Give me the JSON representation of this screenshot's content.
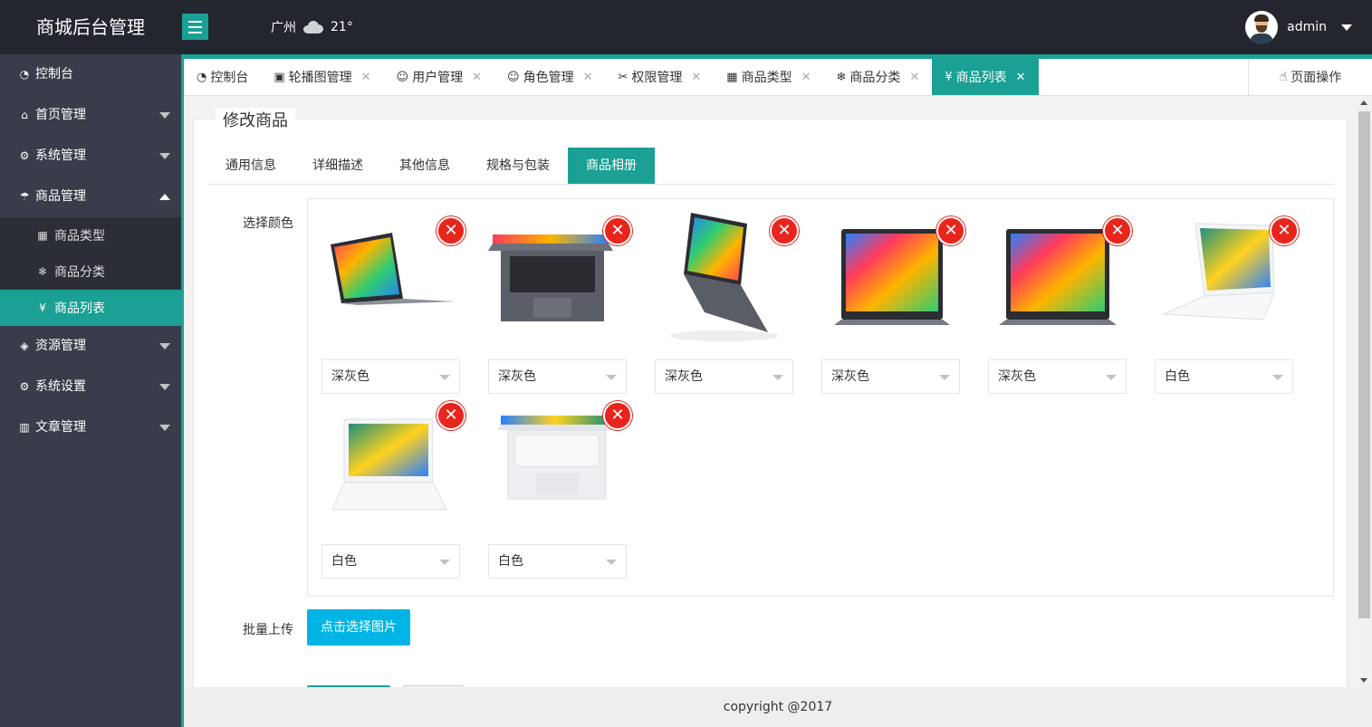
{
  "header": {
    "brand": "商城后台管理",
    "city": "广州",
    "temperature": "21°",
    "username": "admin"
  },
  "sidebar": {
    "items": [
      {
        "label": "控制台",
        "icon": "dashboard-icon"
      },
      {
        "label": "首页管理",
        "icon": "home-icon"
      },
      {
        "label": "系统管理",
        "icon": "gear-icon"
      },
      {
        "label": "商品管理",
        "icon": "umbrella-icon",
        "expanded": true
      },
      {
        "label": "资源管理",
        "icon": "cube-icon"
      },
      {
        "label": "系统设置",
        "icon": "gear-icon"
      },
      {
        "label": "文章管理",
        "icon": "book-icon"
      }
    ],
    "sub_items": [
      {
        "label": "商品类型",
        "icon": "grid-icon"
      },
      {
        "label": "商品分类",
        "icon": "snowflake-icon"
      },
      {
        "label": "商品列表",
        "icon": "yen-icon",
        "active": true
      }
    ]
  },
  "tabs": [
    {
      "label": "控制台",
      "icon": "dashboard-icon",
      "closable": false
    },
    {
      "label": "轮播图管理",
      "icon": "image-icon",
      "closable": true
    },
    {
      "label": "用户管理",
      "icon": "users-icon",
      "closable": true
    },
    {
      "label": "角色管理",
      "icon": "user-icon",
      "closable": true
    },
    {
      "label": "权限管理",
      "icon": "tools-icon",
      "closable": true
    },
    {
      "label": "商品类型",
      "icon": "grid-icon",
      "closable": true
    },
    {
      "label": "商品分类",
      "icon": "snowflake-icon",
      "closable": true
    },
    {
      "label": "商品列表",
      "icon": "yen-icon",
      "closable": true,
      "active": true
    }
  ],
  "page_ops": "页面操作",
  "form": {
    "title": "修改商品",
    "tabs": [
      "通用信息",
      "详细描述",
      "其他信息",
      "规格与包装",
      "商品相册"
    ],
    "active_tab": "商品相册",
    "color_label": "选择颜色",
    "upload_label": "批量上传",
    "upload_button": "点击选择图片",
    "gallery": [
      {
        "color": "深灰色",
        "variant": "gray-side"
      },
      {
        "color": "深灰色",
        "variant": "gray-keyboard"
      },
      {
        "color": "深灰色",
        "variant": "gray-tilt"
      },
      {
        "color": "深灰色",
        "variant": "gray-front"
      },
      {
        "color": "深灰色",
        "variant": "gray-front"
      },
      {
        "color": "白色",
        "variant": "white-angle"
      },
      {
        "color": "白色",
        "variant": "white-front"
      },
      {
        "color": "白色",
        "variant": "white-keyboard"
      }
    ]
  },
  "footer": "copyright @2017",
  "colors": {
    "accent": "#1aa094",
    "header_bg": "#23262e",
    "sidebar_bg": "#393d49",
    "upload_btn": "#00b5e5",
    "delete": "#e8251c"
  }
}
